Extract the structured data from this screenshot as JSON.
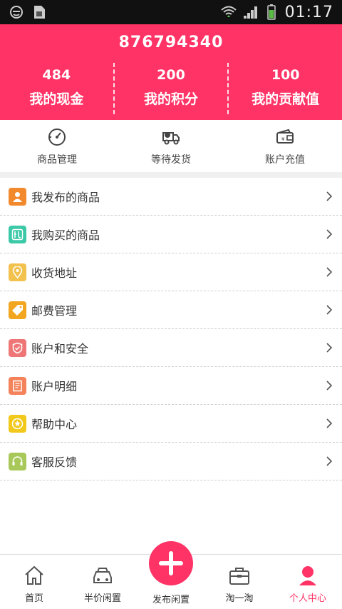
{
  "status_bar": {
    "time": "01:17"
  },
  "header": {
    "user_id": "876794340",
    "stats": [
      {
        "value": "484",
        "label": "我的现金"
      },
      {
        "value": "200",
        "label": "我的积分"
      },
      {
        "value": "100",
        "label": "我的贡献值"
      }
    ]
  },
  "quick_actions": [
    {
      "label": "商品管理",
      "icon": "gauge-icon"
    },
    {
      "label": "等待发货",
      "icon": "truck-icon"
    },
    {
      "label": "账户充值",
      "icon": "wallet-icon"
    }
  ],
  "menu": [
    {
      "label": "我发布的商品",
      "icon": "person-icon",
      "color": "#f28a2d"
    },
    {
      "label": "我购买的商品",
      "icon": "gift-icon",
      "color": "#3cc9a8"
    },
    {
      "label": "收货地址",
      "icon": "location-icon",
      "color": "#f2c14e"
    },
    {
      "label": "邮费管理",
      "icon": "tag-icon",
      "color": "#f2a51e"
    },
    {
      "label": "账户和安全",
      "icon": "shield-icon",
      "color": "#ef7676"
    },
    {
      "label": "账户明细",
      "icon": "document-icon",
      "color": "#f4825a"
    },
    {
      "label": "帮助中心",
      "icon": "star-icon",
      "color": "#f2c81a"
    },
    {
      "label": "客服反馈",
      "icon": "headset-icon",
      "color": "#a8c95a"
    }
  ],
  "bottom_nav": [
    {
      "label": "首页",
      "icon": "home-icon"
    },
    {
      "label": "半价闲置",
      "icon": "car-icon"
    },
    {
      "label": "发布闲置",
      "icon": "plus-icon"
    },
    {
      "label": "淘一淘",
      "icon": "briefcase-icon"
    },
    {
      "label": "个人中心",
      "icon": "user-icon",
      "active": true
    }
  ],
  "colors": {
    "accent": "#ff3366",
    "divider": "#cfcfcf"
  }
}
